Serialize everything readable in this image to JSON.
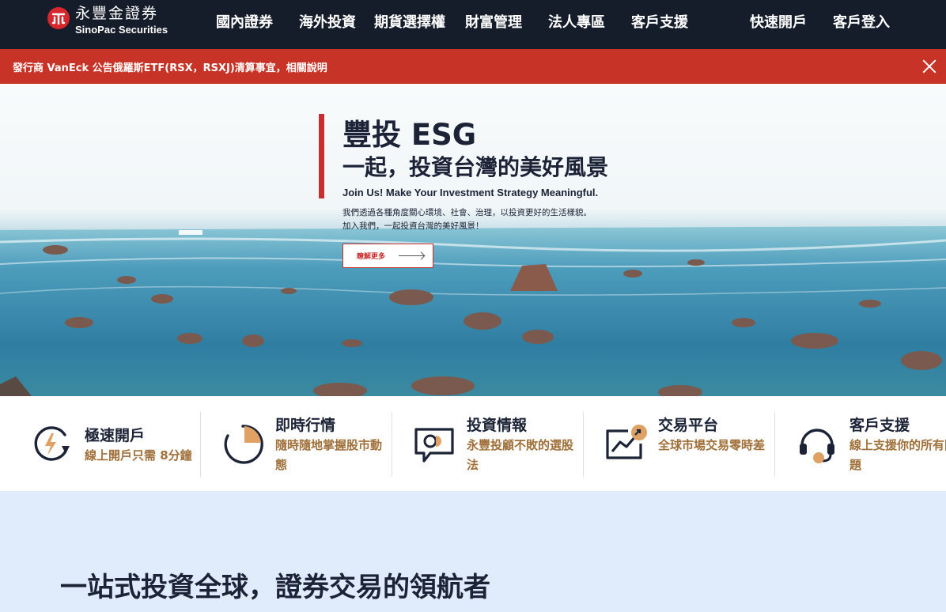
{
  "brand": {
    "name_zh": "永豐金證券",
    "name_en": "SinoPac Securities",
    "logo_color": "#d8262d"
  },
  "nav": {
    "items": [
      "國內證券",
      "海外投資",
      "期貨選擇權",
      "財富管理",
      "法人專區",
      "客戶支援"
    ],
    "open_account": "快速開戶",
    "login": "客戶登入"
  },
  "alert": {
    "text": "發行商 VanEck 公告俄羅斯ETF(RSX，RSXJ)清算事宜，相關說明",
    "close_icon": "close-icon",
    "background": "#c83327"
  },
  "hero": {
    "title": "豐投 ESG",
    "subtitle": "一起，投資台灣的美好風景",
    "tagline_en": "Join Us! Make Your Investment Strategy Meaningful.",
    "desc_line1": "我們透過各種角度關心環境、社會、治理，以投資更好的生活樣貌。",
    "desc_line2": "加入我們，一起投資台灣的美好風景！",
    "cta": "瞭解更多"
  },
  "features": [
    {
      "title": "極速開戶",
      "desc": "線上開戶只需 8分鐘",
      "icon": "lightning-refresh-icon"
    },
    {
      "title": "即時行情",
      "desc": "隨時隨地掌握股市動態",
      "icon": "pie-chart-icon"
    },
    {
      "title": "投資情報",
      "desc": "永豐投顧不敗的選股法",
      "icon": "chat-chart-icon"
    },
    {
      "title": "交易平台",
      "desc": "全球市場交易零時差",
      "icon": "trend-up-icon"
    },
    {
      "title": "客戶支援",
      "desc": "線上支援你的所有問題",
      "icon": "headset-icon"
    }
  ],
  "bottom": {
    "headline": "一站式投資全球，證券交易的領航者"
  },
  "colors": {
    "nav_bg": "#151c2a",
    "accent_red": "#c92d2d",
    "accent_gold": "#d9a26a",
    "bottom_bg": "#e0ebfb"
  }
}
